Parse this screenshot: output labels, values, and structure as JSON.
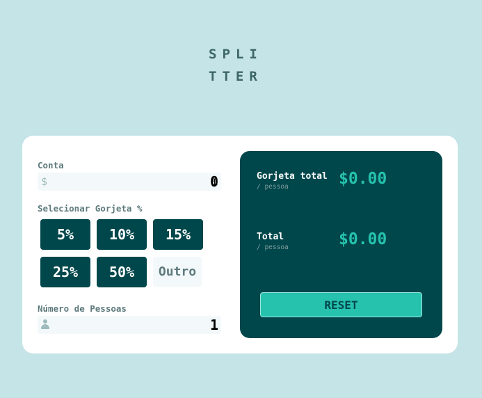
{
  "logo": {
    "line1": "SPLI",
    "line2": "TTER"
  },
  "bill": {
    "label": "Conta",
    "prefix": "$",
    "value": "0"
  },
  "tip": {
    "label": "Selecionar Gorjeta %",
    "options": [
      "5%",
      "10%",
      "15%",
      "25%",
      "50%"
    ],
    "custom_placeholder": "Outro"
  },
  "people": {
    "label": "Número de Pessoas",
    "value": "1"
  },
  "results": {
    "tip_label": "Gorjeta total",
    "tip_sub": "/ pessoa",
    "tip_amount": "$0.00",
    "total_label": "Total",
    "total_sub": "/ pessoa",
    "total_amount": "$0.00"
  },
  "reset_label": "RESET",
  "colors": {
    "background": "#c5e4e7",
    "dark_cyan": "#00474b",
    "strong_cyan": "#26c2ad",
    "grayish_cyan": "#5e7a7d"
  }
}
